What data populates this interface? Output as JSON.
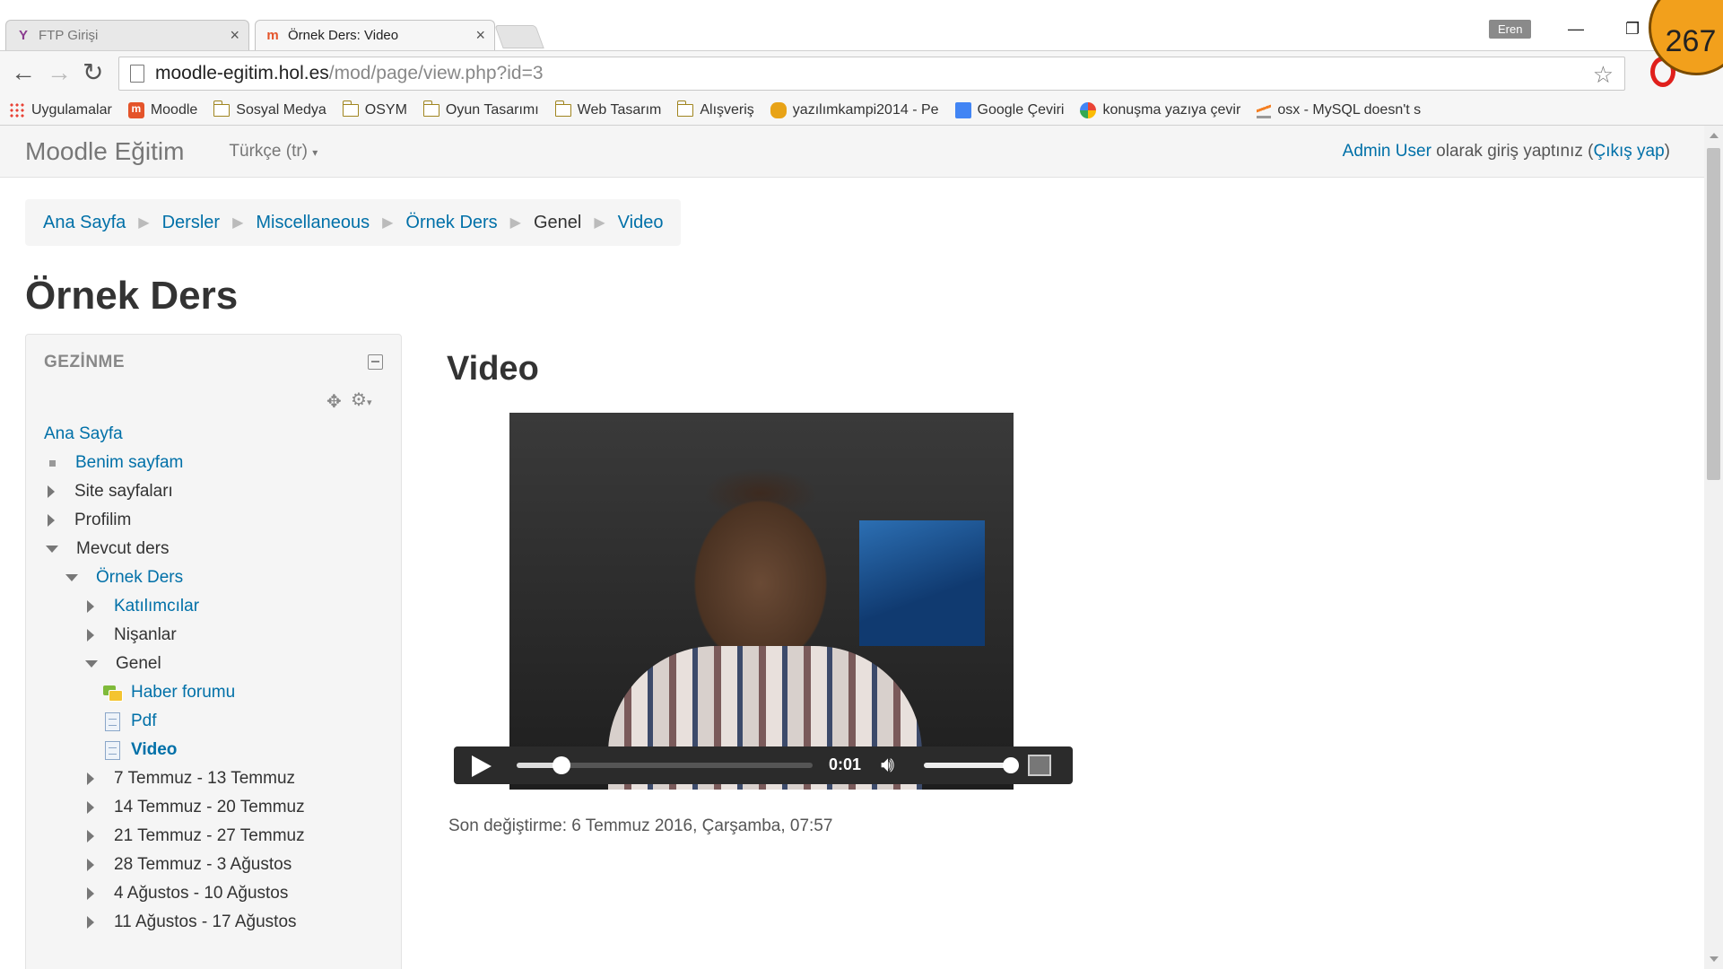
{
  "browser": {
    "tabs": [
      {
        "title": "FTP Girişi",
        "active": false
      },
      {
        "title": "Örnek Ders: Video",
        "active": true
      }
    ],
    "profile_name": "Eren",
    "counter": "267",
    "url_host": "moodle-egitim.hol.es",
    "url_path": "/mod/page/view.php?id=3",
    "bookmarks": [
      {
        "label": "Uygulamalar",
        "icon": "apps-icon"
      },
      {
        "label": "Moodle",
        "icon": "moodle-icon"
      },
      {
        "label": "Sosyal Medya",
        "icon": "folder-icon"
      },
      {
        "label": "OSYM",
        "icon": "folder-icon"
      },
      {
        "label": "Oyun Tasarımı",
        "icon": "folder-icon"
      },
      {
        "label": "Web Tasarım",
        "icon": "folder-icon"
      },
      {
        "label": "Alışveriş",
        "icon": "folder-icon"
      },
      {
        "label": "yazılımkampi2014 - Pe",
        "icon": "tiger-icon"
      },
      {
        "label": "Google Çeviri",
        "icon": "translate-icon"
      },
      {
        "label": "konuşma yazıya çevir",
        "icon": "google-icon"
      },
      {
        "label": "osx - MySQL doesn't s",
        "icon": "stackoverflow-icon"
      }
    ]
  },
  "navbar": {
    "brand": "Moodle Eğitim",
    "language": "Türkçe (tr)",
    "login_user": "Admin User",
    "login_text": " olarak giriş yaptınız (",
    "logout": "Çıkış yap",
    "login_close": ")"
  },
  "breadcrumb": [
    {
      "label": "Ana Sayfa",
      "link": true
    },
    {
      "label": "Dersler",
      "link": true
    },
    {
      "label": "Miscellaneous",
      "link": true
    },
    {
      "label": "Örnek Ders",
      "link": true
    },
    {
      "label": "Genel",
      "link": false
    },
    {
      "label": "Video",
      "link": true
    }
  ],
  "page_title": "Örnek Ders",
  "navigation_block": {
    "title": "GEZİNME",
    "items": [
      {
        "label": "Ana Sayfa",
        "link": true
      },
      {
        "label": "Benim sayfam",
        "link": true
      },
      {
        "label": "Site sayfaları",
        "link": false
      },
      {
        "label": "Profilim",
        "link": false
      },
      {
        "label": "Mevcut ders",
        "link": false
      },
      {
        "label": "Örnek Ders",
        "link": true
      },
      {
        "label": "Katılımcılar",
        "link": true
      },
      {
        "label": "Nişanlar",
        "link": false
      },
      {
        "label": "Genel",
        "link": false
      },
      {
        "label": "Haber forumu",
        "link": true
      },
      {
        "label": "Pdf",
        "link": true
      },
      {
        "label": "Video",
        "link": true,
        "current": true
      },
      {
        "label": "7 Temmuz - 13 Temmuz",
        "link": false
      },
      {
        "label": "14 Temmuz - 20 Temmuz",
        "link": false
      },
      {
        "label": "21 Temmuz - 27 Temmuz",
        "link": false
      },
      {
        "label": "28 Temmuz - 3 Ağustos",
        "link": false
      },
      {
        "label": "4 Ağustos - 10 Ağustos",
        "link": false
      },
      {
        "label": "11 Ağustos - 17 Ağustos",
        "link": false
      }
    ]
  },
  "main": {
    "heading": "Video",
    "player": {
      "time": "0:01",
      "progress": 0.15,
      "volume": 1.0
    },
    "modified": "Son değiştirme: 6 Temmuz 2016, Çarşamba, 07:57"
  },
  "colors": {
    "link": "#0070a8",
    "navbar_bg": "#f5f5f5",
    "counter_badge": "#f2a01c"
  }
}
